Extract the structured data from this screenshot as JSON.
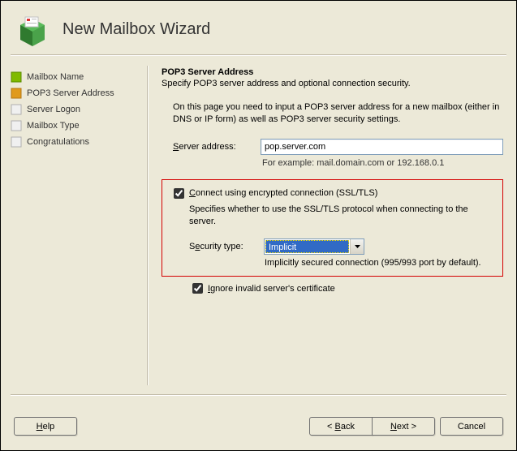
{
  "header": {
    "title": "New Mailbox Wizard"
  },
  "sidebar": {
    "steps": [
      {
        "label": "Mailbox Name",
        "state": "done"
      },
      {
        "label": "POP3 Server Address",
        "state": "current"
      },
      {
        "label": "Server Logon",
        "state": "pending"
      },
      {
        "label": "Mailbox Type",
        "state": "pending"
      },
      {
        "label": "Congratulations",
        "state": "pending"
      }
    ]
  },
  "main": {
    "page_title": "POP3 Server Address",
    "page_subtitle": "Specify POP3 server address and optional connection security.",
    "instruction": "On this page you need to input a POP3 server address for a new mailbox (either in DNS or IP form) as well as POP3 server security settings.",
    "server_label": "Server address:",
    "server_value": "pop.server.com",
    "server_hint": "For example: mail.domain.com or 192.168.0.1",
    "ssl_check_label": "Connect using encrypted connection (SSL/TLS)",
    "ssl_checked": true,
    "ssl_desc": "Specifies whether to use the SSL/TLS protocol when connecting to the server.",
    "security_label": "Security type:",
    "security_value": "Implicit",
    "security_hint": "Implicitly secured connection (995/993 port by default).",
    "ignore_label": "Ignore invalid server's certificate",
    "ignore_checked": true
  },
  "buttons": {
    "help": "Help",
    "back": "< Back",
    "next": "Next >",
    "cancel": "Cancel"
  }
}
